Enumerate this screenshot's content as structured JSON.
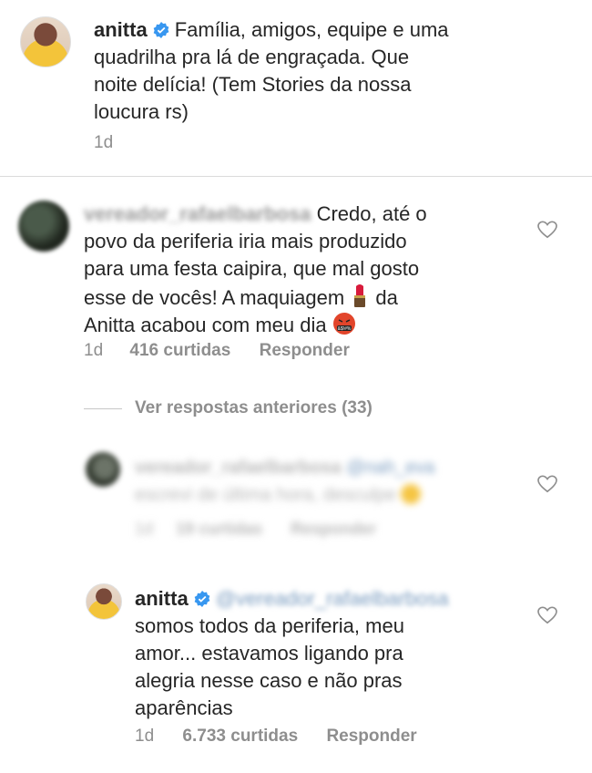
{
  "caption": {
    "username": "anitta",
    "text": "Família, amigos, equipe e uma quadrilha pra lá de engraçada. Que noite delícia! (Tem Stories da nossa loucura rs)",
    "lines": [
      "Família, amigos, equipe e uma",
      "quadrilha pra lá de engraçada. Que",
      "noite delícia! (Tem Stories da nossa",
      "loucura rs)"
    ],
    "time": "1d"
  },
  "comment1": {
    "username": "vereador_rafaelbarbosa",
    "lines": [
      "Credo, até o",
      "povo da periferia iria mais produzido",
      "para uma festa caipira, que mal gosto",
      "esse de vocês! A maquiagem",
      "da",
      "Anitta acabou com meu dia"
    ],
    "time": "1d",
    "likes": "416 curtidas",
    "reply_label": "Responder",
    "emoji_lipstick": "lipstick-emoji",
    "emoji_angry": "cursing-face-emoji"
  },
  "view_replies": "Ver respostas anteriores (33)",
  "reply1": {
    "username": "vereador_rafaelbarbosa",
    "mention": "@nah_eva",
    "text": "escrevi de última hora, desculpe",
    "time": "1d",
    "likes": "19 curtidas",
    "reply_label": "Responder"
  },
  "reply2": {
    "username": "anitta",
    "mention": "@vereador_rafaelbarbosa",
    "lines": [
      "somos todos da periferia, meu",
      "amor... estavamos ligando pra",
      "alegria nesse caso e não pras",
      "aparências"
    ],
    "time": "1d",
    "likes": "6.733 curtidas",
    "reply_label": "Responder"
  },
  "colors": {
    "verified": "#3897f0",
    "meta": "#8e8e8e",
    "text": "#262626",
    "mention": "#003569"
  }
}
